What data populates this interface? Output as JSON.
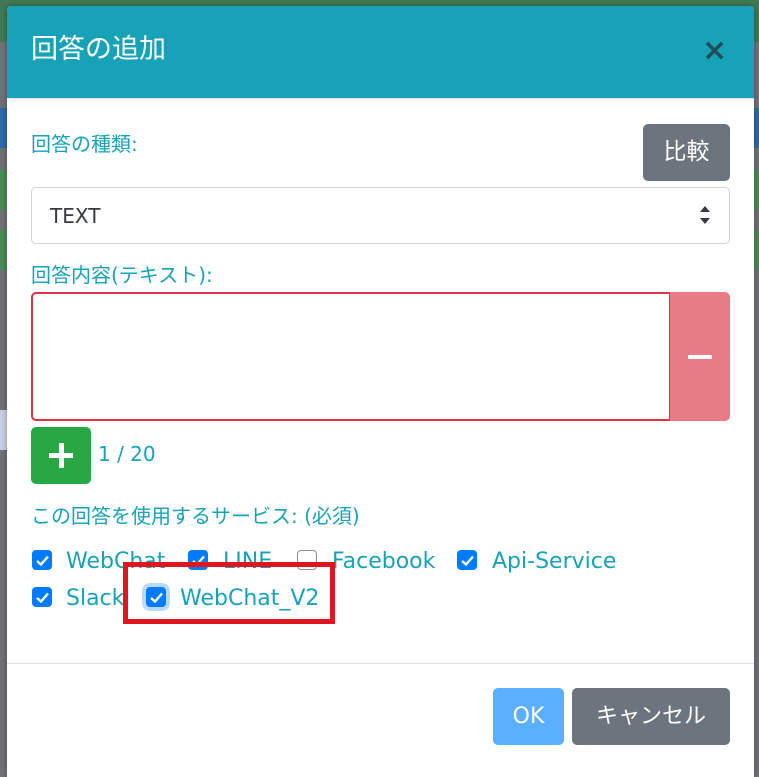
{
  "dialog": {
    "title": "回答の追加",
    "close_label": "×"
  },
  "form": {
    "answer_type_label": "回答の種類:",
    "compare_label": "比較",
    "answer_type_value": "TEXT",
    "content_label": "回答内容(テキスト):",
    "content_value": "",
    "counter": "1 / 20",
    "services_label": "この回答を使用するサービス: (必須)",
    "services": [
      {
        "label": "WebChat",
        "checked": true
      },
      {
        "label": "LINE",
        "checked": true
      },
      {
        "label": "Facebook",
        "checked": false
      },
      {
        "label": "Api-Service",
        "checked": true
      },
      {
        "label": "Slack",
        "checked": true
      },
      {
        "label": "WebChat_V2",
        "checked": true
      }
    ]
  },
  "footer": {
    "ok_label": "OK",
    "cancel_label": "キャンセル"
  },
  "colors": {
    "header_bg": "#17a2b8",
    "primary": "#007bff",
    "danger": "#dc3545",
    "success": "#28a745",
    "secondary": "#6c757d",
    "highlight": "#e0161e"
  }
}
